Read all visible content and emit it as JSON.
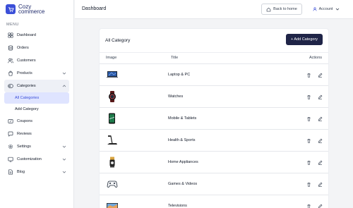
{
  "brand": {
    "line1": "Cozy",
    "line2": "commerce",
    "accent": "#3b4fd8"
  },
  "sidebar": {
    "menu_label": "MENU",
    "items": [
      {
        "label": "Dashboard",
        "icon": "dashboard-icon"
      },
      {
        "label": "Orders",
        "icon": "orders-icon"
      },
      {
        "label": "Customers",
        "icon": "customers-icon"
      },
      {
        "label": "Products",
        "icon": "products-icon",
        "expandable": true
      },
      {
        "label": "Categories",
        "icon": "categories-icon",
        "expandable": true,
        "expanded": true
      },
      {
        "label": "Coupons",
        "icon": "coupons-icon"
      },
      {
        "label": "Reviews",
        "icon": "reviews-icon"
      },
      {
        "label": "Settings",
        "icon": "settings-icon",
        "expandable": true
      },
      {
        "label": "Customization",
        "icon": "customization-icon",
        "expandable": true
      },
      {
        "label": "Blog",
        "icon": "blog-icon",
        "expandable": true
      }
    ],
    "categories_sub": [
      {
        "label": "All Categories",
        "active": true
      },
      {
        "label": "Add Category"
      }
    ]
  },
  "header": {
    "title": "Dashboard",
    "back_home": "Back to home",
    "account": "Account"
  },
  "card": {
    "title": "All Category",
    "add_button": "+ Add Category",
    "columns": {
      "image": "Image",
      "title": "Title",
      "actions": "Actions"
    },
    "rows": [
      {
        "title": "Laptop & PC",
        "image": "laptop-image"
      },
      {
        "title": "Watches",
        "image": "watch-image"
      },
      {
        "title": "Mobile & Tablets",
        "image": "phone-image"
      },
      {
        "title": "Health & Sports",
        "image": "treadmill-image"
      },
      {
        "title": "Home Appliances",
        "image": "appliance-image"
      },
      {
        "title": "Games & Videos",
        "image": "gamepad-image"
      },
      {
        "title": "Televisions",
        "image": "tv-image"
      }
    ]
  }
}
